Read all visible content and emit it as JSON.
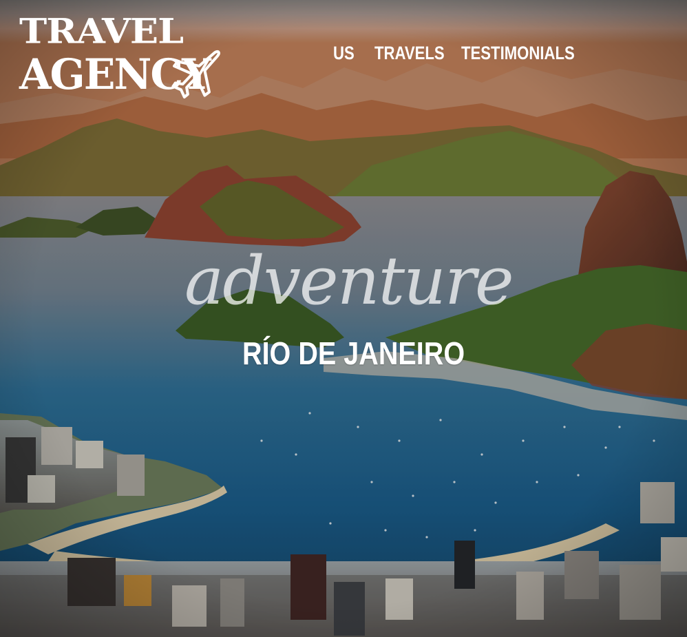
{
  "brand": {
    "line1": "TRAVEL",
    "line2": "AGENCY",
    "icon": "airplane-icon"
  },
  "nav": {
    "items": [
      {
        "label": "US"
      },
      {
        "label": "TRAVELS"
      },
      {
        "label": "TESTIMONIALS"
      }
    ]
  },
  "hero": {
    "script_word": "adventure",
    "destination": "RÍO DE JANEIRO",
    "background_image": "aerial-view-rio-de-janeiro-bay"
  },
  "colors": {
    "text": "#ffffff",
    "water": "#1f5f86",
    "sky": "#b89a86",
    "mountains_warm": "#a35a33",
    "greenery": "#3d6b2e"
  }
}
